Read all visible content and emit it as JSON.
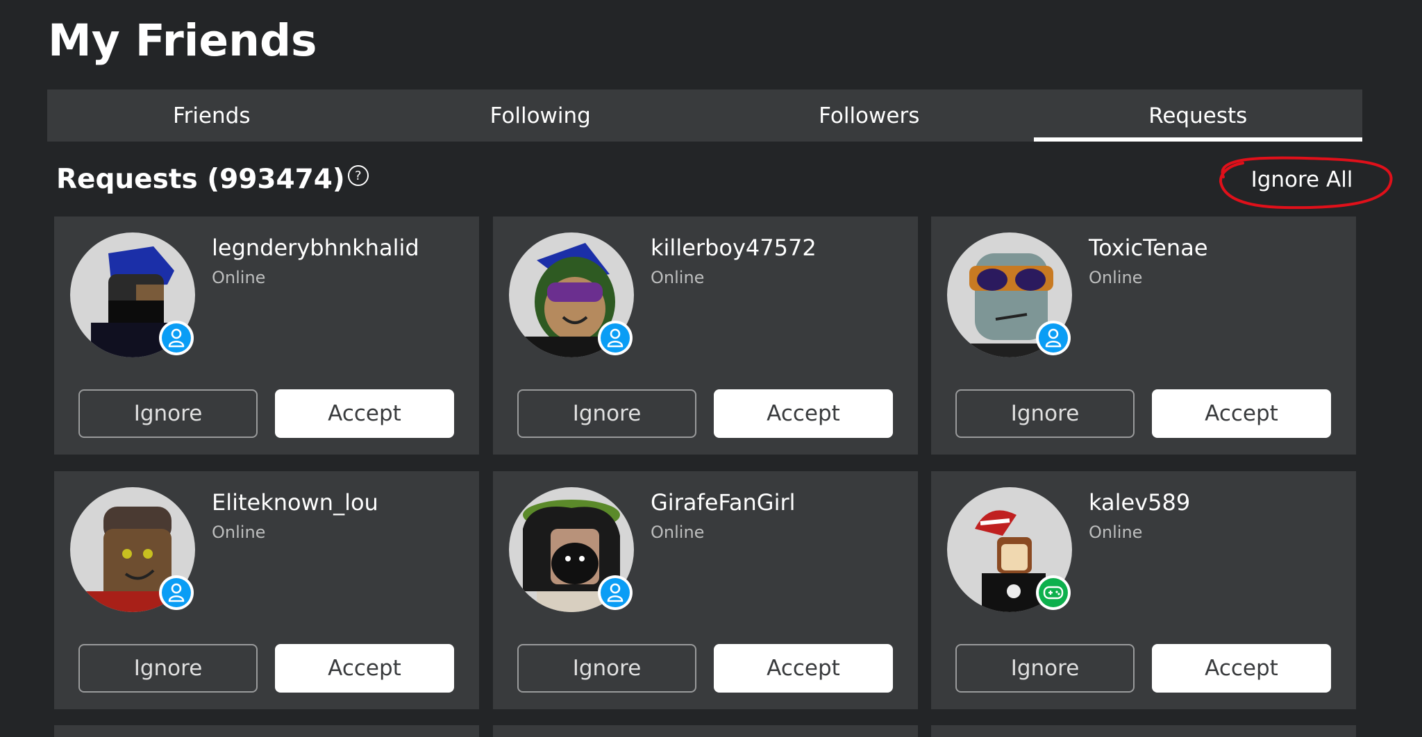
{
  "page": {
    "title": "My Friends"
  },
  "tabs": [
    {
      "label": "Friends",
      "active": false
    },
    {
      "label": "Following",
      "active": false
    },
    {
      "label": "Followers",
      "active": false
    },
    {
      "label": "Requests",
      "active": true
    }
  ],
  "requests": {
    "title": "Requests (993474)",
    "help_icon": "?",
    "ignore_all_label": "Ignore All"
  },
  "cards": [
    {
      "username": "legnderybhnkhalid",
      "status": "Online",
      "badge": "user-icon",
      "ignore_label": "Ignore",
      "accept_label": "Accept"
    },
    {
      "username": "killerboy47572",
      "status": "Online",
      "badge": "user-icon",
      "ignore_label": "Ignore",
      "accept_label": "Accept"
    },
    {
      "username": "ToxicTenae",
      "status": "Online",
      "badge": "user-icon",
      "ignore_label": "Ignore",
      "accept_label": "Accept"
    },
    {
      "username": "Eliteknown_lou",
      "status": "Online",
      "badge": "user-icon",
      "ignore_label": "Ignore",
      "accept_label": "Accept"
    },
    {
      "username": "GirafeFanGirl",
      "status": "Online",
      "badge": "user-icon",
      "ignore_label": "Ignore",
      "accept_label": "Accept"
    },
    {
      "username": "kalev589",
      "status": "Online",
      "badge": "game-controller-icon",
      "ignore_label": "Ignore",
      "accept_label": "Accept"
    }
  ],
  "colors": {
    "background": "#232527",
    "card": "#393b3d",
    "badge_blue": "#0a9df5",
    "badge_green": "#0db04d",
    "annotation_red": "#e0101a"
  }
}
